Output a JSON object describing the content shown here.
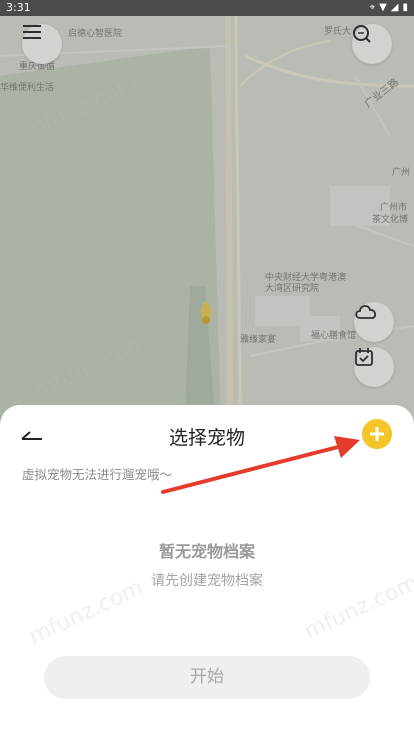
{
  "status_bar": {
    "time": "3:31"
  },
  "map": {
    "labels": [
      {
        "text": "启德心智医院"
      },
      {
        "text": "罗氏大"
      },
      {
        "text": "重庆御循"
      },
      {
        "text": "华维便利生活"
      },
      {
        "text": "广州"
      },
      {
        "text": "广州市"
      },
      {
        "text": "茶文化博"
      },
      {
        "text": "中央财经大学粤港澳"
      },
      {
        "text": "大湾区研究院"
      },
      {
        "text": "雅缘家宴"
      },
      {
        "text": "福心膳食馆"
      }
    ],
    "road_label": "广业三路"
  },
  "sheet": {
    "title": "选择宠物",
    "hint": "虚拟宠物无法进行遛宠哦～",
    "empty_title": "暂无宠物档案",
    "empty_subtitle": "请先创建宠物档案",
    "start_button": "开始"
  },
  "watermark": "mfunz.com",
  "colors": {
    "accent": "#f5c428",
    "arrow": "#e53b2c"
  }
}
